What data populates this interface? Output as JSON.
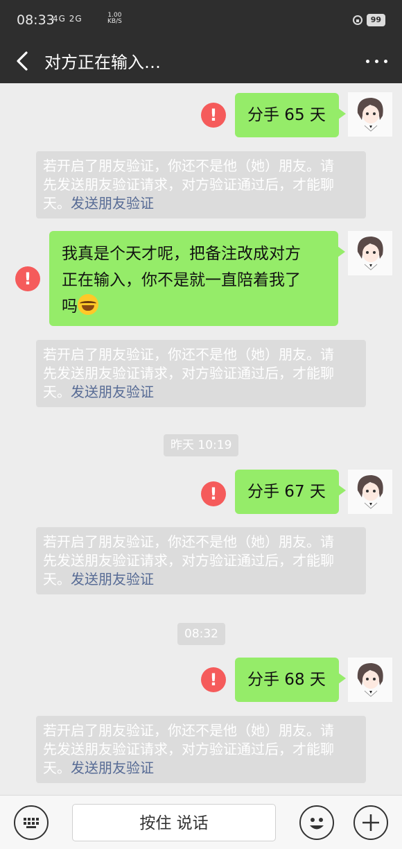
{
  "status_bar": {
    "time": "08:33",
    "signal": "4G 2G",
    "speed_value": "1.00",
    "speed_unit": "KB/S",
    "battery": "99"
  },
  "header": {
    "title": "对方正在输入…"
  },
  "messages": [
    {
      "text": "分手 65 天"
    },
    {
      "text_line1": "我真是个天才呢，把备注改成对方",
      "text_line2": "正在输入，你不是就一直陪着我了",
      "text_line3": "吗"
    },
    {
      "text": "分手 67 天"
    },
    {
      "text": "分手 68 天"
    }
  ],
  "notice": {
    "line1": "若开启了朋友验证，你还不是他（她）朋友。请",
    "line2": "先发送朋友验证请求，对方验证通过后，才能聊",
    "line3_prefix": "天。",
    "link": "发送朋友验证"
  },
  "timestamps": [
    "昨天 10:19",
    "08:32"
  ],
  "error_icon_text": "!",
  "input_bar": {
    "voice_label": "按住 说话"
  },
  "colors": {
    "bubble": "#95ec69",
    "error": "#f55b5b",
    "link": "#576b95",
    "header": "#2e2e2e"
  }
}
